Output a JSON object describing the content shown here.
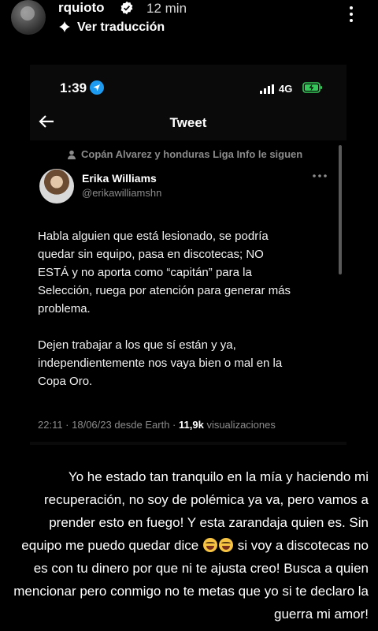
{
  "story": {
    "username": "rquioto",
    "time": "12 min",
    "translate_label": "Ver traducción"
  },
  "screenshot": {
    "status_time": "1:39",
    "network": "4G",
    "title": "Tweet",
    "tweet": {
      "social_context": "Copán Alvarez y honduras Liga Info le siguen",
      "author_name": "Erika Williams",
      "author_handle": "@erikawilliamshn",
      "body": "Habla alguien que está lesionado, se podría\nquedar sin equipo, pasa en discotecas; NO\nESTÁ y no aporta como “capitán” para la\nSelección, ruega por atención para generar más\nproblema.\n\nDejen trabajar a los que sí están y ya,\nindependientemente nos vaya bien o mal en la\nCopa Oro.",
      "date_text": "22:11 · 18/06/23 desde Earth · ",
      "views_count": "11,9k",
      "views_label": " visualizaciones"
    }
  },
  "caption": {
    "before_emoji": "Yo he estado tan tranquilo en la mía y haciendo mi recuperación, no soy de polémica ya va, pero vamos a prender esto en fuego! Y esta zarandaja quien es. Sin equipo me puedo quedar dice ",
    "emoji_names": [
      "face-with-tears-of-joy-icon",
      "face-with-tears-of-joy-icon"
    ],
    "after_emoji": " si voy a discotecas no es con tu dinero por que ni te ajusta creo! Busca a quien mencionar pero conmigo no te metas que yo si te declaro la guerra mi amor!"
  },
  "colors": {
    "background": "#000000",
    "verified_badge": "#ffffff",
    "location_badge": "#1d9bf0",
    "battery_charge": "#35c759",
    "muted_text": "#8b8b8b"
  }
}
